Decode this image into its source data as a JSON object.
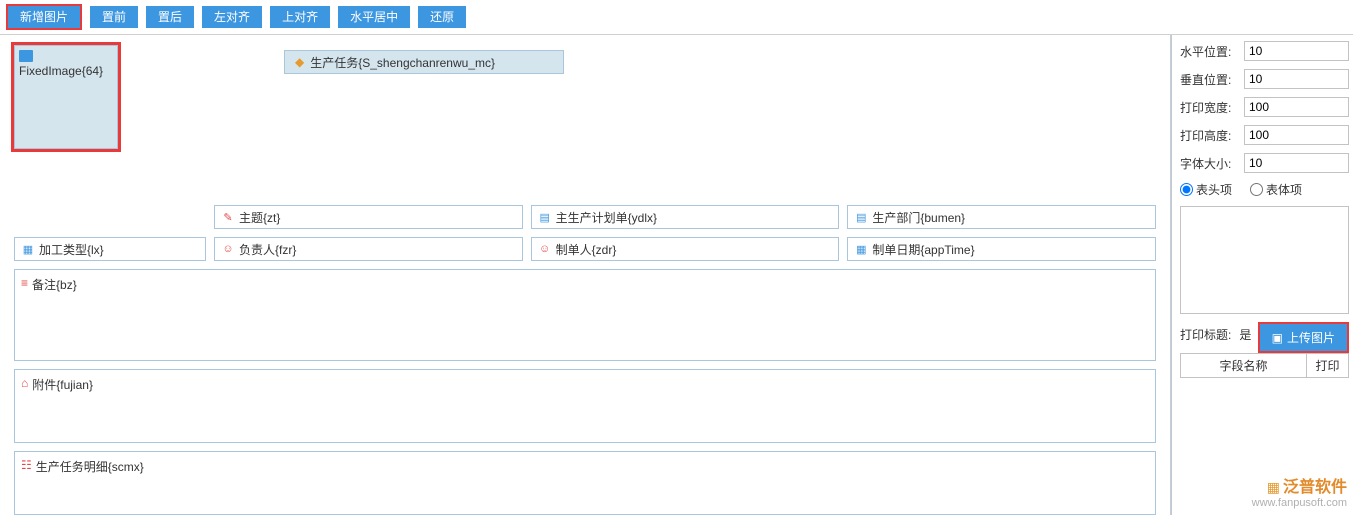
{
  "toolbar": {
    "add_image": "新增图片",
    "bring_front": "置前",
    "send_back": "置后",
    "align_left": "左对齐",
    "align_top": "上对齐",
    "center_h": "水平居中",
    "restore": "还原"
  },
  "canvas": {
    "fixed_image_label": "FixedImage{64}",
    "task_title": "生产任务{S_shengchanrenwu_mc}",
    "fields": {
      "subject": "主题{zt}",
      "main_plan": "主生产计划单{ydlx}",
      "dept": "生产部门{bumen}",
      "proc_type": "加工类型{lx}",
      "owner": "负责人{fzr}",
      "maker": "制单人{zdr}",
      "make_date": "制单日期{appTime}",
      "remark": "备注{bz}",
      "attach": "附件{fujian}",
      "detail": "生产任务明细{scmx}"
    }
  },
  "sidebar": {
    "hpos_label": "水平位置:",
    "hpos_value": "10",
    "vpos_label": "垂直位置:",
    "vpos_value": "10",
    "pwidth_label": "打印宽度:",
    "pwidth_value": "100",
    "pheight_label": "打印高度:",
    "pheight_value": "100",
    "fontsize_label": "字体大小:",
    "fontsize_value": "10",
    "radio_header": "表头项",
    "radio_body": "表体项",
    "upload_label": "上传图片",
    "print_title_label": "打印标题:",
    "print_title_value": "是",
    "col_field_name": "字段名称",
    "col_print": "打印"
  },
  "logo": {
    "cn": "泛普软件",
    "en": "www.fanpusoft.com"
  }
}
